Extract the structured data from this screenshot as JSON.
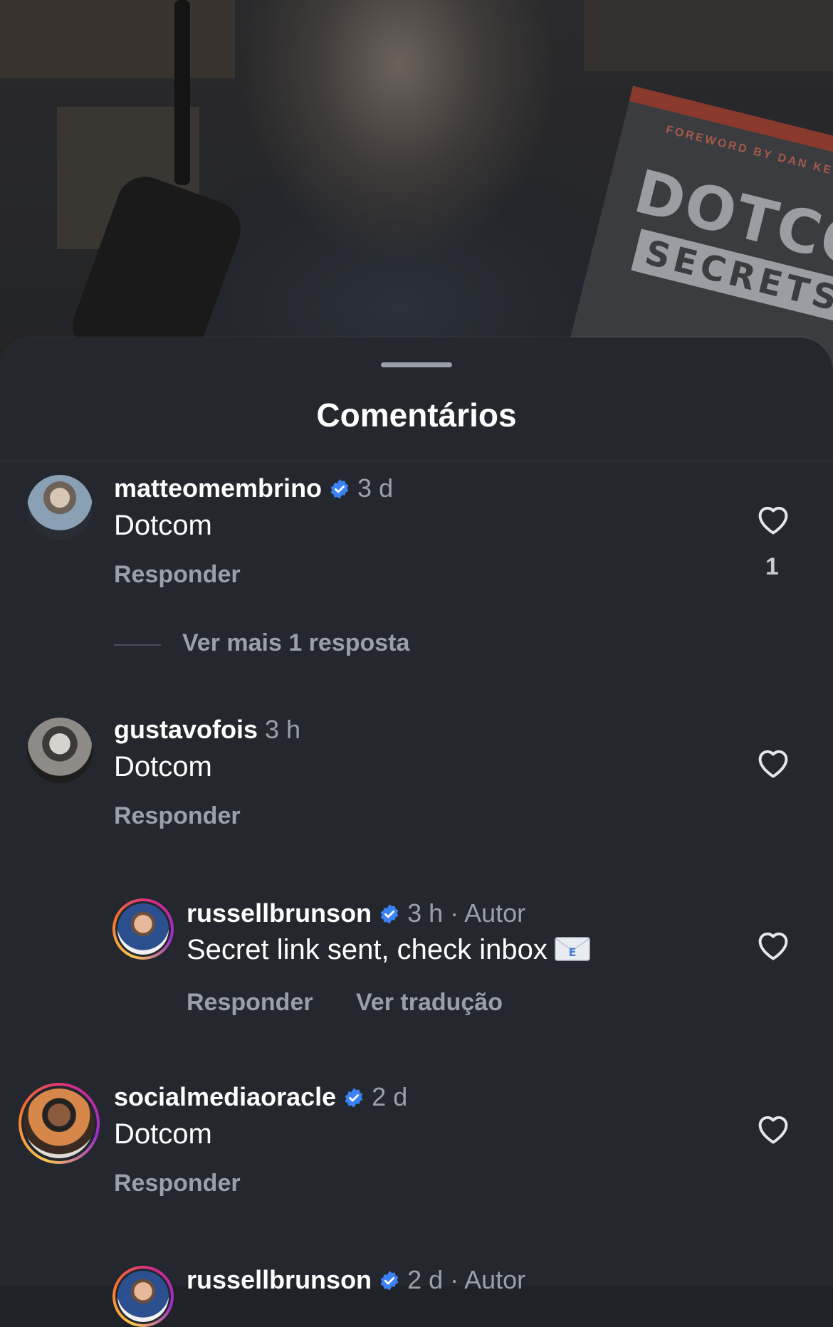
{
  "sheet": {
    "title": "Comentários"
  },
  "video": {
    "book_title": "DOTCOM",
    "book_subtitle": "SECRETS",
    "book_foreword": "FOREWORD BY DAN KENNEDY"
  },
  "comments": [
    {
      "username": "matteomembrino",
      "verified": true,
      "time": "3 d",
      "text": "Dotcom",
      "reply_label": "Responder",
      "likes": "1",
      "more_replies": "Ver mais 1 resposta"
    },
    {
      "username": "gustavofois",
      "verified": false,
      "time": "3 h",
      "text": "Dotcom",
      "reply_label": "Responder"
    },
    {
      "username": "russellbrunson",
      "verified": true,
      "time": "3 h · Autor",
      "text": "Secret link sent, check inbox",
      "reply_label": "Responder",
      "translate_label": "Ver tradução"
    },
    {
      "username": "socialmediaoracle",
      "verified": true,
      "time": "2 d",
      "text": "Dotcom",
      "reply_label": "Responder"
    },
    {
      "username": "russellbrunson",
      "verified": true,
      "time": "2 d · Autor"
    }
  ],
  "colors": {
    "background": "#24272d",
    "verified": "#3b82f6",
    "muted": "#9aa0a8"
  }
}
